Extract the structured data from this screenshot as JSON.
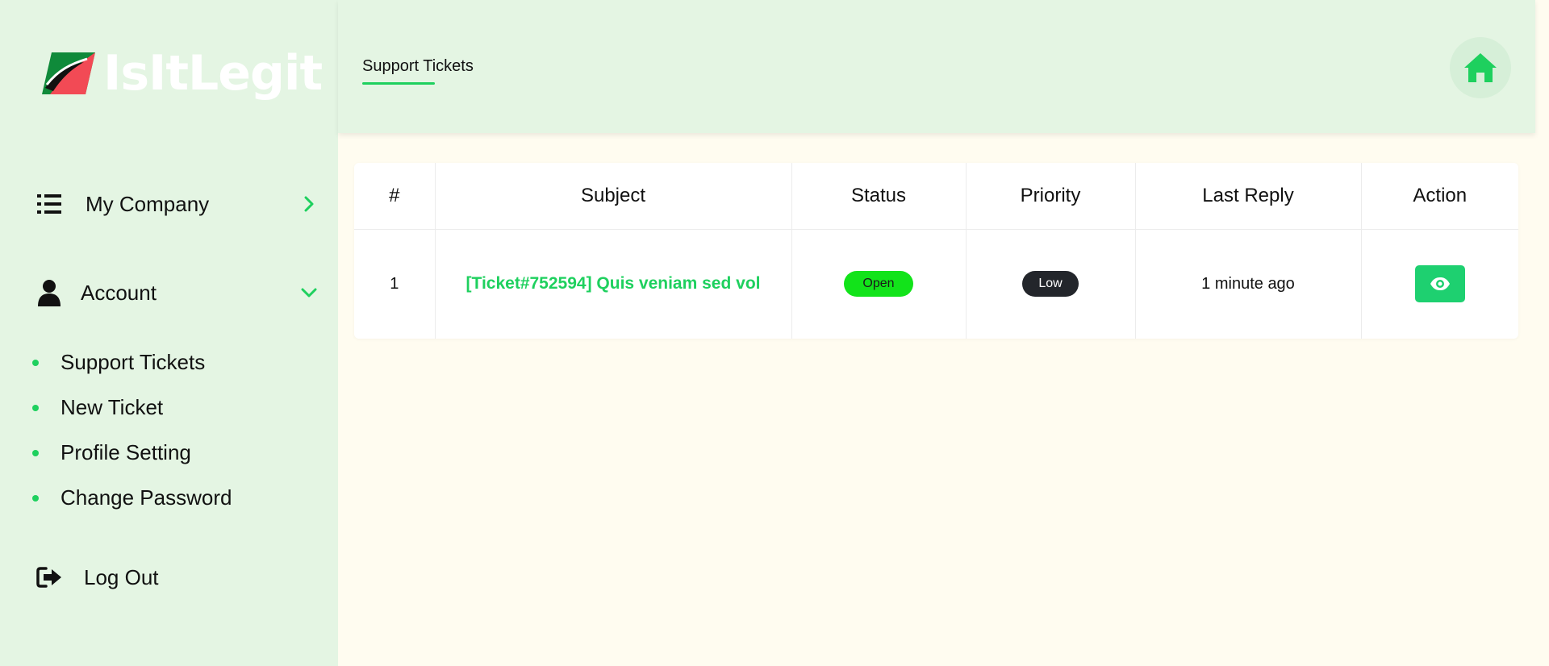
{
  "brand": {
    "name": "IsItLegit"
  },
  "sidebar": {
    "my_company": "My Company",
    "account": "Account",
    "sub_items": [
      {
        "label": "Support Tickets"
      },
      {
        "label": "New Ticket"
      },
      {
        "label": "Profile Setting"
      },
      {
        "label": "Change Password"
      }
    ],
    "logout": "Log Out"
  },
  "header": {
    "title": "Support Tickets"
  },
  "table": {
    "columns": [
      "#",
      "Subject",
      "Status",
      "Priority",
      "Last Reply",
      "Action"
    ],
    "rows": [
      {
        "number": "1",
        "subject": "[Ticket#752594] Quis veniam sed vol",
        "status": "Open",
        "priority": "Low",
        "last_reply": "1 minute ago"
      }
    ]
  },
  "colors": {
    "accent": "#1ed05e",
    "sidebar_bg": "#e4f5e3",
    "page_bg": "#fffcf0",
    "status_open": "#12e31a",
    "priority_low": "#23262b"
  }
}
